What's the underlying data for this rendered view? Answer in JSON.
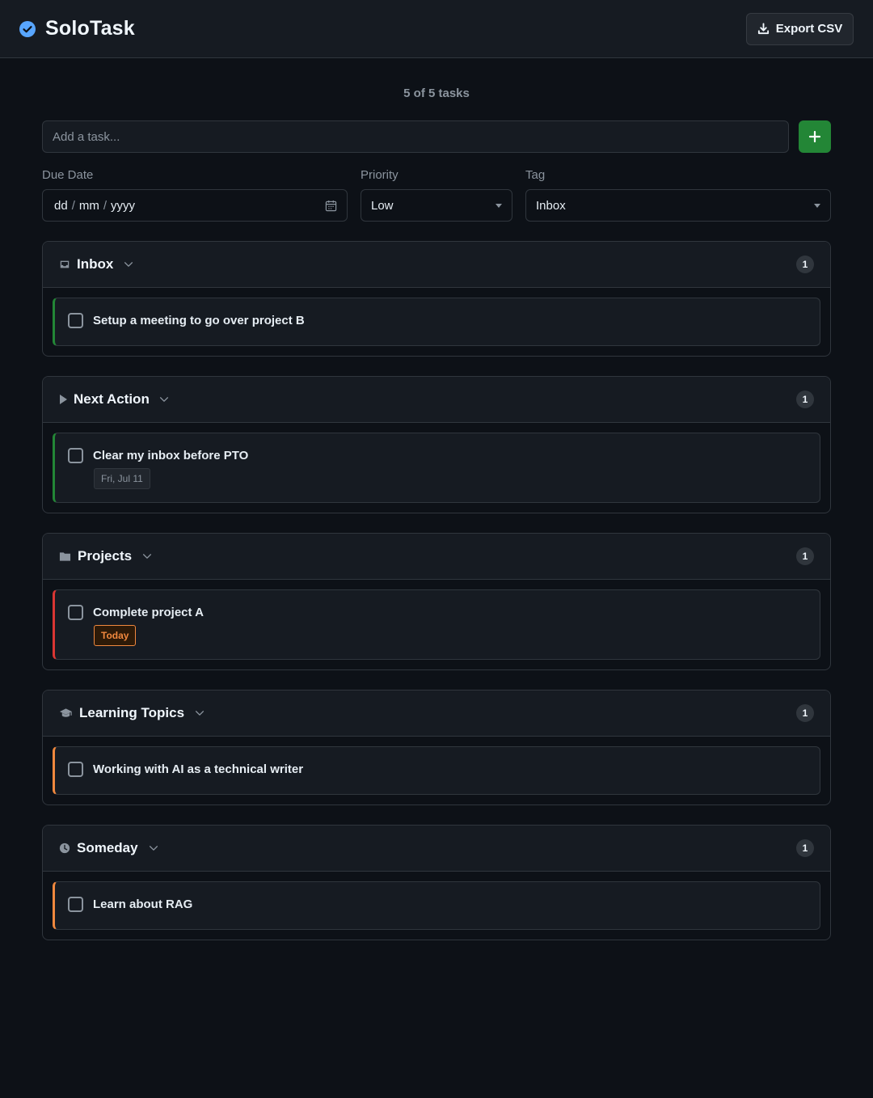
{
  "app": {
    "title": "SoloTask",
    "export_label": "Export CSV",
    "brand_color": "#58a6ff"
  },
  "summary": {
    "task_count": "5 of 5 tasks"
  },
  "add_form": {
    "placeholder": "Add a task...",
    "due_label": "Due Date",
    "date_dd": "dd",
    "date_mm": "mm",
    "date_yyyy": "yyyy",
    "date_sep": "/",
    "priority_label": "Priority",
    "priority_value": "Low",
    "tag_label": "Tag",
    "tag_value": "Inbox"
  },
  "sections": [
    {
      "name": "Inbox",
      "icon": "inbox-icon",
      "count": "1",
      "tasks": [
        {
          "text": "Setup a meeting to go over project B",
          "priority_color": "#238636"
        }
      ]
    },
    {
      "name": "Next Action",
      "icon": "play-icon",
      "count": "1",
      "tasks": [
        {
          "text": "Clear my inbox before PTO",
          "priority_color": "#238636",
          "due": "Fri, Jul 11"
        }
      ]
    },
    {
      "name": "Projects",
      "icon": "folder-icon",
      "count": "1",
      "tasks": [
        {
          "text": "Complete project A",
          "priority_color": "#da3633",
          "due": "Today"
        }
      ]
    },
    {
      "name": "Learning Topics",
      "icon": "graduation-cap-icon",
      "count": "1",
      "tasks": [
        {
          "text": "Working with AI as a technical writer",
          "priority_color": "#f0883e"
        }
      ]
    },
    {
      "name": "Someday",
      "icon": "clock-icon",
      "count": "1",
      "tasks": [
        {
          "text": "Learn about RAG",
          "priority_color": "#f0883e"
        }
      ]
    }
  ]
}
